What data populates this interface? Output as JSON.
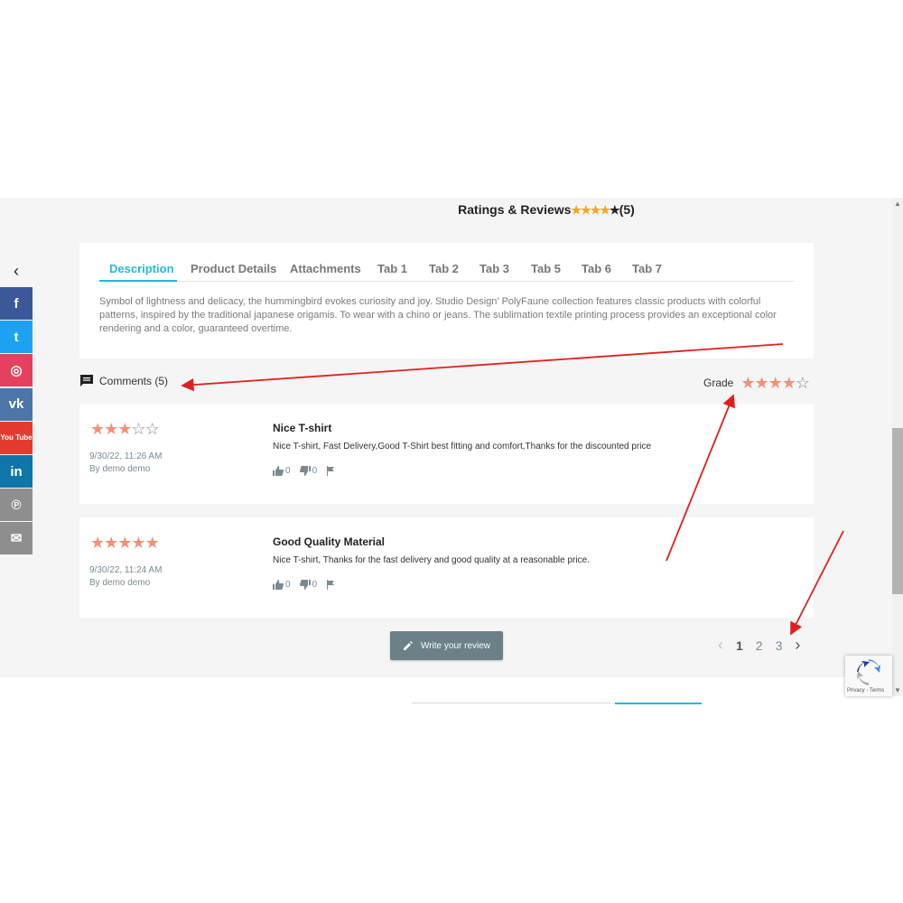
{
  "header": {
    "title": "Ratings & Reviews",
    "stars": "★★★★",
    "star_last": "★",
    "count": "(5)"
  },
  "social": {
    "back": "‹",
    "items": [
      {
        "name": "facebook",
        "glyph": "f",
        "color": "#3b5998"
      },
      {
        "name": "twitter",
        "glyph": "t",
        "color": "#1da1f2"
      },
      {
        "name": "instagram",
        "glyph": "◎",
        "color": "#e4405f"
      },
      {
        "name": "vk",
        "glyph": "vk",
        "color": "#4a76a8"
      },
      {
        "name": "youtube",
        "glyph": "You Tube",
        "color": "#e33c2f"
      },
      {
        "name": "linkedin",
        "glyph": "in",
        "color": "#0e76a8"
      },
      {
        "name": "pinterest",
        "glyph": "℗",
        "color": "#8e8e8e"
      },
      {
        "name": "email",
        "glyph": "✉",
        "color": "#8e8e8e"
      }
    ]
  },
  "tabs": [
    "Description",
    "Product Details",
    "Attachments",
    "Tab 1",
    "Tab 2",
    "Tab 3",
    "Tab 5",
    "Tab 6",
    "Tab 7"
  ],
  "description": "Symbol of lightness and delicacy, the hummingbird evokes curiosity and joy. Studio Design' PolyFaune collection features classic products with colorful patterns, inspired by the traditional japanese origamis. To wear with a chino or jeans. The sublimation textile printing process provides an exceptional color rendering and a color, guaranteed overtime.",
  "comments": {
    "label": "Comments (5)",
    "grade_label": "Grade",
    "grade": 4,
    "max": 5
  },
  "reviews": [
    {
      "rating": 3,
      "date": "9/30/22, 11:26 AM",
      "author": "By demo demo",
      "title": "Nice T-shirt",
      "text": "Nice T-shirt, Fast Delivery,Good T-Shirt best fitting and comfort,Thanks for the discounted price",
      "likes": "0",
      "dislikes": "0"
    },
    {
      "rating": 5,
      "date": "9/30/22, 11:24 AM",
      "author": "By demo demo",
      "title": "Good Quality Material",
      "text": "Nice T-shirt, Thanks for the fast delivery and good quality at a reasonable price.",
      "likes": "0",
      "dislikes": "0"
    }
  ],
  "write_review": "Write your review",
  "pagination": {
    "prev": "‹",
    "pages": [
      "1",
      "2",
      "3"
    ],
    "current": "1",
    "next": "›"
  },
  "recaptcha": {
    "label": "Privacy - Terms"
  },
  "colors": {
    "accent": "#25b9d7",
    "star_orange": "#f0927a",
    "annotation_arrow": "#e02020"
  }
}
